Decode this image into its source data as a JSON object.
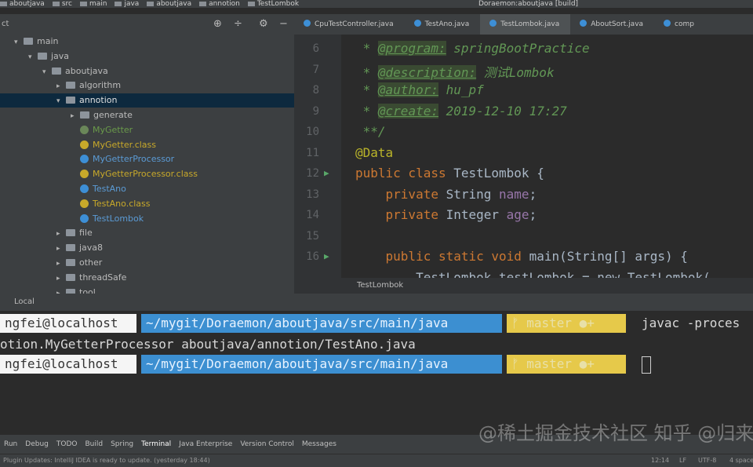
{
  "breadcrumb": [
    "aboutjava",
    "src",
    "main",
    "java",
    "aboutjava",
    "annotion",
    "TestLombok"
  ],
  "run_config": "Doraemon:aboutjava [build]",
  "project": {
    "header": "ct",
    "tree": [
      {
        "label": "main",
        "depth": 0,
        "arrow": "▾",
        "kind": "folder",
        "color": "#bbbbbb"
      },
      {
        "label": "java",
        "depth": 1,
        "arrow": "▾",
        "kind": "folder",
        "color": "#bbbbbb"
      },
      {
        "label": "aboutjava",
        "depth": 2,
        "arrow": "▾",
        "kind": "folder",
        "color": "#bbbbbb"
      },
      {
        "label": "algorithm",
        "depth": 3,
        "arrow": "▸",
        "kind": "folder",
        "color": "#bbbbbb"
      },
      {
        "label": "annotion",
        "depth": 3,
        "arrow": "▾",
        "kind": "folder",
        "color": "#e0e0e0",
        "selected": true
      },
      {
        "label": "generate",
        "depth": 4,
        "arrow": "▸",
        "kind": "folder",
        "color": "#bbbbbb"
      },
      {
        "label": "MyGetter",
        "depth": 4,
        "arrow": "",
        "kind": "class",
        "color": "#6a9a4a",
        "icon": "#6a8759"
      },
      {
        "label": "MyGetter.class",
        "depth": 4,
        "arrow": "",
        "kind": "class",
        "color": "#c8a92a",
        "icon": "#c8a92a"
      },
      {
        "label": "MyGetterProcessor",
        "depth": 4,
        "arrow": "",
        "kind": "class",
        "color": "#5b9bd5",
        "icon": "#3d8fd6"
      },
      {
        "label": "MyGetterProcessor.class",
        "depth": 4,
        "arrow": "",
        "kind": "class",
        "color": "#c8a92a",
        "icon": "#c8a92a"
      },
      {
        "label": "TestAno",
        "depth": 4,
        "arrow": "",
        "kind": "class",
        "color": "#5b9bd5",
        "icon": "#3d8fd6"
      },
      {
        "label": "TestAno.class",
        "depth": 4,
        "arrow": "",
        "kind": "class",
        "color": "#c8a92a",
        "icon": "#c8a92a"
      },
      {
        "label": "TestLombok",
        "depth": 4,
        "arrow": "",
        "kind": "class",
        "color": "#5b9bd5",
        "icon": "#3d8fd6"
      },
      {
        "label": "file",
        "depth": 3,
        "arrow": "▸",
        "kind": "folder",
        "color": "#bbbbbb"
      },
      {
        "label": "java8",
        "depth": 3,
        "arrow": "▸",
        "kind": "folder",
        "color": "#bbbbbb"
      },
      {
        "label": "other",
        "depth": 3,
        "arrow": "▸",
        "kind": "folder",
        "color": "#bbbbbb"
      },
      {
        "label": "threadSafe",
        "depth": 3,
        "arrow": "▸",
        "kind": "folder",
        "color": "#bbbbbb"
      },
      {
        "label": "tool",
        "depth": 3,
        "arrow": "▸",
        "kind": "folder",
        "color": "#bbbbbb"
      }
    ]
  },
  "tabs": [
    {
      "label": "CpuTestController.java",
      "active": false
    },
    {
      "label": "TestAno.java",
      "active": false
    },
    {
      "label": "TestLombok.java",
      "active": true
    },
    {
      "label": "AboutSort.java",
      "active": false
    },
    {
      "label": "comp",
      "active": false
    }
  ],
  "editor": {
    "lines": [
      {
        "n": "6",
        "html": "<span class='cm'> * </span><span class='tag'>@program:</span><span class='cm'> springBootPractice</span>"
      },
      {
        "n": "7",
        "html": "<span class='cm'> * </span><span class='tag'>@description:</span><span class='cm'> 测试Lombok</span>"
      },
      {
        "n": "8",
        "html": "<span class='cm'> * </span><span class='tag'>@author:</span><span class='cm'> hu_pf</span>"
      },
      {
        "n": "9",
        "html": "<span class='cm'> * </span><span class='tag'>@create:</span><span class='cm'> 2019-12-10 17:27</span>"
      },
      {
        "n": "10",
        "html": "<span class='cm'> **/</span>"
      },
      {
        "n": "11",
        "html": "<span class='ann'>@Data</span>"
      },
      {
        "n": "12",
        "html": "<span class='kw'>public class </span>TestLombok {"
      },
      {
        "n": "13",
        "html": "    <span class='kw'>private </span>String <span class='fld'>name</span>;"
      },
      {
        "n": "14",
        "html": "    <span class='kw'>private </span>Integer <span class='fld'>age</span>;"
      },
      {
        "n": "15",
        "html": ""
      },
      {
        "n": "16",
        "html": "    <span class='kw'>public static void </span>main(String[] args) {"
      },
      {
        "n": "",
        "html": "        TestLombok testLombok = new TestLombok("
      }
    ],
    "footer": "TestLombok"
  },
  "local_tab": "Local",
  "terminal": {
    "line1": {
      "user": "ngfei@localhost",
      "path": "~/mygit/Doraemon/aboutjava/src/main/java",
      "branch": "master",
      "command": "javac -proces"
    },
    "line2": "otion.MyGetterProcessor aboutjava/annotion/TestAno.java",
    "line3": {
      "user": "ngfei@localhost",
      "path": "~/mygit/Doraemon/aboutjava/src/main/java",
      "branch": "master"
    }
  },
  "toolbar": [
    "Run",
    "Debug",
    "TODO",
    "Build",
    "Spring",
    "Terminal",
    "Java Enterprise",
    "Version Control",
    "Messages"
  ],
  "status": {
    "message": "Plugin Updates: IntelliJ IDEA is ready to update. (yesterday 18:44)",
    "position": "12:14",
    "line_sep": "LF",
    "encoding": "UTF-8",
    "indent": "4 spaces"
  },
  "watermark": "@稀土掘金技术社区  知乎 @归来兮",
  "colors": {
    "accent": "#4a88c7",
    "path_segment": "#3c8fd1",
    "branch_segment": "#e6c94a",
    "selection": "#0d293e"
  }
}
